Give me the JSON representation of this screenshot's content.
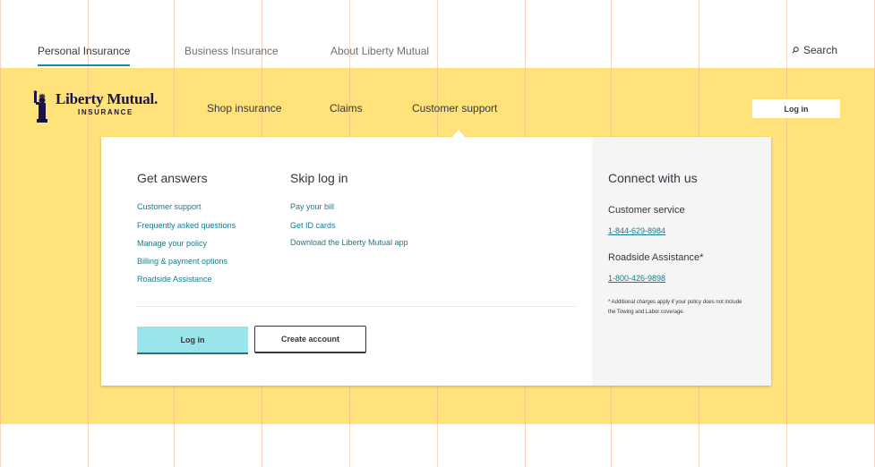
{
  "top_tabs": [
    {
      "label": "Personal Insurance",
      "active": true
    },
    {
      "label": "Business Insurance",
      "active": false
    },
    {
      "label": "About Liberty Mutual",
      "active": false
    }
  ],
  "search_label": "Search",
  "logo": {
    "name": "Liberty Mutual.",
    "sub": "INSURANCE"
  },
  "main_nav": [
    "Shop insurance",
    "Claims",
    "Customer support"
  ],
  "login_top_label": "Log in",
  "dropdown": {
    "get_answers": {
      "heading": "Get answers",
      "links": [
        "Customer support",
        "Frequently asked questions",
        "Manage your policy",
        "Billing & payment options",
        "Roadside Assistance"
      ]
    },
    "skip_login": {
      "heading": "Skip log in",
      "links": [
        "Pay your bill",
        "Get ID cards",
        "Download the Liberty Mutual app"
      ]
    },
    "login_button": "Log in",
    "create_account_button": "Create account",
    "connect": {
      "heading": "Connect with us",
      "customer_service_label": "Customer service",
      "customer_service_phone": "1-844-629-8984",
      "roadside_label": "Roadside Assistance*",
      "roadside_phone": "1-800-426-9898",
      "fine_print": "* Additional charges apply if your policy does not include the Towing and Labor coverage."
    }
  },
  "colors": {
    "band": "#ffe37a",
    "teal": "#1a7a8a",
    "login_button": "#99e5ea",
    "navy": "#1a1446"
  },
  "icons": [
    "search-icon",
    "statue-of-liberty-icon"
  ]
}
